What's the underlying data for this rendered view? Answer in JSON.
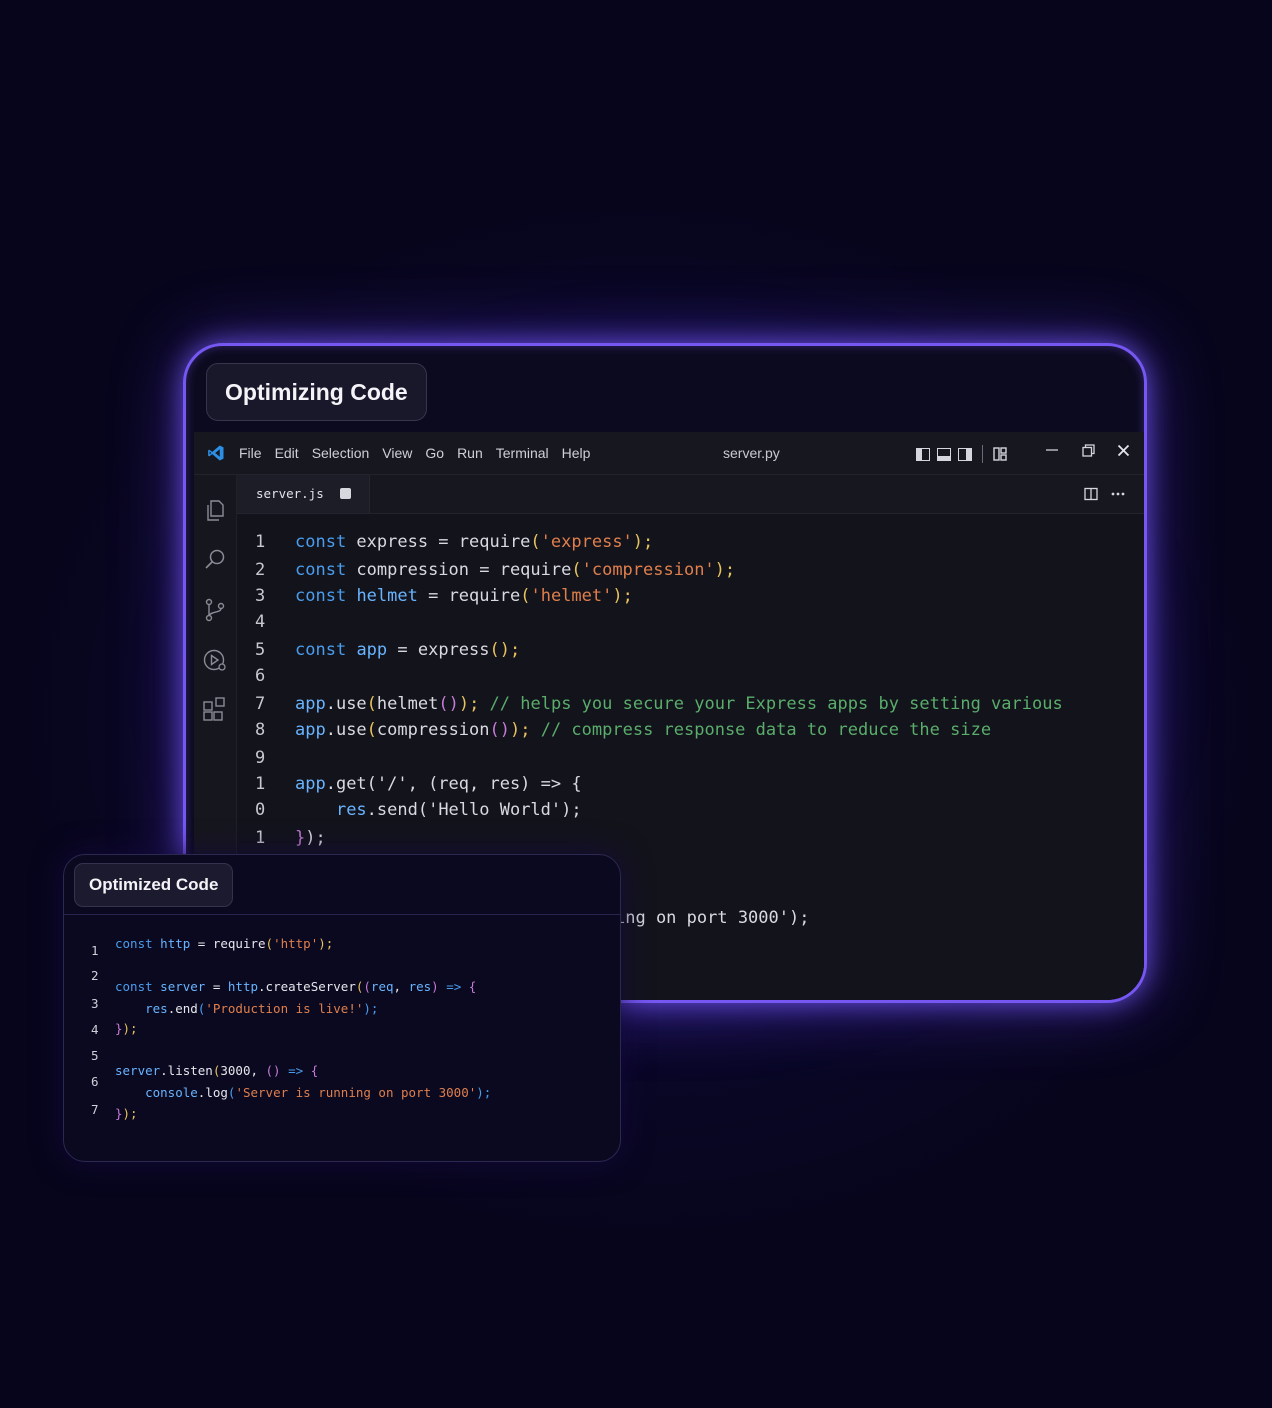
{
  "main_card": {
    "title": "Optimizing Code"
  },
  "menu": [
    "File",
    "Edit",
    "Selection",
    "View",
    "Go",
    "Run",
    "Terminal",
    "Help"
  ],
  "window_title": "server.py",
  "tab": {
    "filename": "server.js"
  },
  "editor": {
    "line_numbers": [
      "1",
      "2",
      "3",
      "4",
      "5",
      "6",
      "7",
      "8",
      "9",
      "1",
      "0",
      "1"
    ],
    "lines": [
      [
        {
          "t": "const",
          "c": "kw"
        },
        {
          "t": " express = require",
          "c": "plain"
        },
        {
          "t": "(",
          "c": "paren"
        },
        {
          "t": "'express'",
          "c": "str"
        },
        {
          "t": ");",
          "c": "paren"
        }
      ],
      [
        {
          "t": "const",
          "c": "kw"
        },
        {
          "t": " compression = require",
          "c": "plain"
        },
        {
          "t": "(",
          "c": "paren"
        },
        {
          "t": "'compression'",
          "c": "str"
        },
        {
          "t": ");",
          "c": "paren"
        }
      ],
      [
        {
          "t": "const",
          "c": "kw"
        },
        {
          "t": " ",
          "c": "plain"
        },
        {
          "t": "helmet",
          "c": "var"
        },
        {
          "t": " = require",
          "c": "plain"
        },
        {
          "t": "(",
          "c": "paren"
        },
        {
          "t": "'helmet'",
          "c": "str"
        },
        {
          "t": ");",
          "c": "paren"
        }
      ],
      [],
      [
        {
          "t": "const",
          "c": "kw"
        },
        {
          "t": " ",
          "c": "plain"
        },
        {
          "t": "app",
          "c": "var"
        },
        {
          "t": " = express",
          "c": "plain"
        },
        {
          "t": "();",
          "c": "paren"
        }
      ],
      [],
      [
        {
          "t": "app",
          "c": "var"
        },
        {
          "t": ".use",
          "c": "plain"
        },
        {
          "t": "(",
          "c": "paren"
        },
        {
          "t": "helmet",
          "c": "plain"
        },
        {
          "t": "()",
          "c": "paren2"
        },
        {
          "t": ");",
          "c": "paren"
        },
        {
          "t": " // helps you secure your Express apps by setting various",
          "c": "cmt"
        }
      ],
      [
        {
          "t": "app",
          "c": "var"
        },
        {
          "t": ".use",
          "c": "plain"
        },
        {
          "t": "(",
          "c": "paren"
        },
        {
          "t": "compression",
          "c": "plain"
        },
        {
          "t": "()",
          "c": "paren2"
        },
        {
          "t": ");",
          "c": "paren"
        },
        {
          "t": " // compress response data to reduce the size",
          "c": "cmt"
        }
      ],
      [],
      [
        {
          "t": "app",
          "c": "var"
        },
        {
          "t": ".get('/', (req, res) => {",
          "c": "plain"
        }
      ],
      [
        {
          "t": "    ",
          "c": "plain"
        },
        {
          "t": "res",
          "c": "var"
        },
        {
          "t": ".send('Hello World');",
          "c": "plain"
        }
      ],
      [
        {
          "t": "}",
          "c": "paren2"
        },
        {
          "t": ");",
          "c": "plain"
        }
      ],
      [],
      [],
      [
        {
          "t": "ing on port 3000');",
          "c": "plain"
        }
      ]
    ]
  },
  "optimized_card": {
    "title": "Optimized Code",
    "line_numbers": [
      "1",
      "2",
      "3",
      "4",
      "5",
      "6",
      "7"
    ],
    "lines": [
      [
        {
          "t": "const",
          "c": "o-kw"
        },
        {
          "t": " ",
          "c": ""
        },
        {
          "t": "http",
          "c": "o-var"
        },
        {
          "t": " = require",
          "c": ""
        },
        {
          "t": "(",
          "c": "o-p1"
        },
        {
          "t": "'http'",
          "c": "o-str"
        },
        {
          "t": ");",
          "c": "o-p1"
        }
      ],
      [],
      [
        {
          "t": "const",
          "c": "o-kw"
        },
        {
          "t": " ",
          "c": ""
        },
        {
          "t": "server",
          "c": "o-var"
        },
        {
          "t": " = ",
          "c": ""
        },
        {
          "t": "http",
          "c": "o-var"
        },
        {
          "t": ".createServer",
          "c": ""
        },
        {
          "t": "(",
          "c": "o-p1"
        },
        {
          "t": "(",
          "c": "o-p2"
        },
        {
          "t": "req",
          "c": "o-var"
        },
        {
          "t": ", ",
          "c": ""
        },
        {
          "t": "res",
          "c": "o-var"
        },
        {
          "t": ")",
          "c": "o-p2"
        },
        {
          "t": " => ",
          "c": "o-kw"
        },
        {
          "t": "{",
          "c": "o-p2"
        }
      ],
      [
        {
          "t": "    ",
          "c": ""
        },
        {
          "t": "res",
          "c": "o-var"
        },
        {
          "t": ".end",
          "c": ""
        },
        {
          "t": "(",
          "c": "o-p3"
        },
        {
          "t": "'Production is live!'",
          "c": "o-str"
        },
        {
          "t": ");",
          "c": "o-p3"
        }
      ],
      [
        {
          "t": "}",
          "c": "o-p2"
        },
        {
          "t": ");",
          "c": "o-p1"
        }
      ],
      [],
      [
        {
          "t": "server",
          "c": "o-var"
        },
        {
          "t": ".listen",
          "c": ""
        },
        {
          "t": "(",
          "c": "o-p1"
        },
        {
          "t": "3000, ",
          "c": ""
        },
        {
          "t": "()",
          "c": "o-p2"
        },
        {
          "t": " => ",
          "c": "o-kw"
        },
        {
          "t": "{",
          "c": "o-p2"
        }
      ],
      [
        {
          "t": "    ",
          "c": ""
        },
        {
          "t": "console",
          "c": "o-var"
        },
        {
          "t": ".log",
          "c": ""
        },
        {
          "t": "(",
          "c": "o-p3"
        },
        {
          "t": "'Server is running on port 3000'",
          "c": "o-str"
        },
        {
          "t": ");",
          "c": "o-p3"
        }
      ],
      [
        {
          "t": "}",
          "c": "o-p2"
        },
        {
          "t": ");",
          "c": "o-p1"
        }
      ]
    ]
  }
}
